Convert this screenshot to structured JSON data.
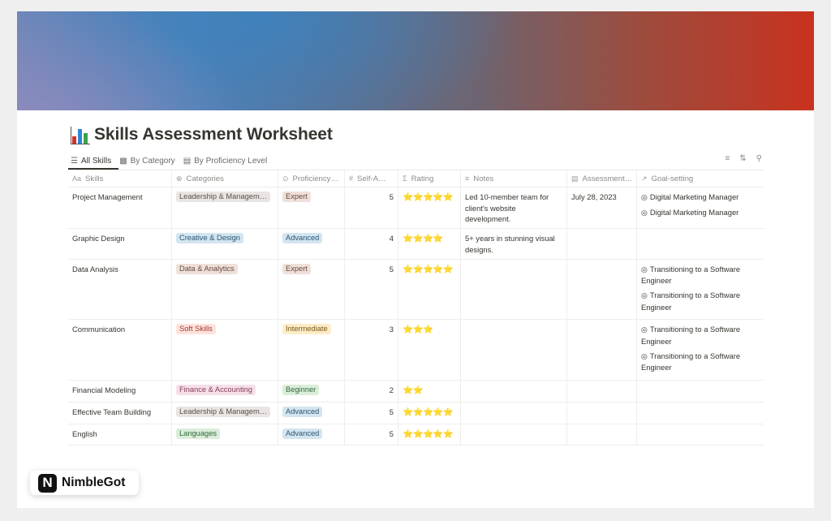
{
  "page": {
    "title": "Skills Assessment Worksheet",
    "title_icon": "bar-chart-emoji"
  },
  "tabs": [
    {
      "label": "All Skills",
      "icon": "layers-icon",
      "active": true
    },
    {
      "label": "By Category",
      "icon": "stack-icon",
      "active": false
    },
    {
      "label": "By Proficiency Level",
      "icon": "bar-chart-icon",
      "active": false
    }
  ],
  "toolbar": {
    "filter_icon": "filter-icon",
    "sort_icon": "sort-icon",
    "search_icon": "search-icon"
  },
  "columns": [
    {
      "label": "Skills",
      "icon": "Aa"
    },
    {
      "label": "Categories",
      "icon": "⊕"
    },
    {
      "label": "Proficiency…",
      "icon": "⊙"
    },
    {
      "label": "Self-A…",
      "icon": "#"
    },
    {
      "label": "Rating",
      "icon": "Σ"
    },
    {
      "label": "Notes",
      "icon": "≡"
    },
    {
      "label": "Assessment…",
      "icon": "▤"
    },
    {
      "label": "Goal-setting",
      "icon": "↗"
    }
  ],
  "rows": [
    {
      "skill": "Project Management",
      "category": "Leadership & Managem…",
      "proficiency": "Expert",
      "score": "5",
      "rating": "⭐⭐⭐⭐⭐",
      "notes": "Led 10-member team for client's website development.",
      "date": "July 28, 2023",
      "goals": [
        "Digital Marketing Manager",
        "Digital Marketing Manager"
      ]
    },
    {
      "skill": "Graphic Design",
      "category": "Creative & Design",
      "proficiency": "Advanced",
      "score": "4",
      "rating": "⭐⭐⭐⭐",
      "notes": "5+ years in stunning visual designs.",
      "date": "",
      "goals": []
    },
    {
      "skill": "Data Analysis",
      "category": "Data & Analytics",
      "proficiency": "Expert",
      "score": "5",
      "rating": "⭐⭐⭐⭐⭐",
      "notes": "",
      "date": "",
      "goals": [
        "Transitioning to a Software Engineer",
        "Transitioning to a Software Engineer"
      ]
    },
    {
      "skill": "Communication",
      "category": "Soft Skills",
      "proficiency": "Intermediate",
      "score": "3",
      "rating": "⭐⭐⭐",
      "notes": "",
      "date": "",
      "goals": [
        "Transitioning to a Software Engineer",
        "Transitioning to a Software Engineer"
      ]
    },
    {
      "skill": "Financial Modeling",
      "category": "Finance & Accounting",
      "proficiency": "Beginner",
      "score": "2",
      "rating": "⭐⭐",
      "notes": "",
      "date": "",
      "goals": []
    },
    {
      "skill": "Effective Team Building",
      "category": "Leadership & Managem…",
      "proficiency": "Advanced",
      "score": "5",
      "rating": "⭐⭐⭐⭐⭐",
      "notes": "",
      "date": "",
      "goals": []
    },
    {
      "skill": "English",
      "category": "Languages",
      "proficiency": "Advanced",
      "score": "5",
      "rating": "⭐⭐⭐⭐⭐",
      "notes": "",
      "date": "",
      "goals": []
    }
  ],
  "tag_colors": {
    "Leadership & Managem…": {
      "bg": "#e9e5e3",
      "fg": "#5a4f47"
    },
    "Creative & Design": {
      "bg": "#d3e5ef",
      "fg": "#2b5574"
    },
    "Data & Analytics": {
      "bg": "#eee0da",
      "fg": "#6b4a3c"
    },
    "Soft Skills": {
      "bg": "#ffe2dd",
      "fg": "#9b3a2f"
    },
    "Finance & Accounting": {
      "bg": "#f5e0e9",
      "fg": "#8a3c5e"
    },
    "Languages": {
      "bg": "#dbeddb",
      "fg": "#2f6a3a"
    },
    "Expert": {
      "bg": "#eee0da",
      "fg": "#6b4a3c"
    },
    "Advanced": {
      "bg": "#d3e5ef",
      "fg": "#2b5574"
    },
    "Intermediate": {
      "bg": "#fdecc8",
      "fg": "#7a5a16"
    },
    "Beginner": {
      "bg": "#dbeddb",
      "fg": "#2f6a3a"
    }
  },
  "badge": {
    "logo_letter": "N",
    "brand": "NimbleGot"
  }
}
